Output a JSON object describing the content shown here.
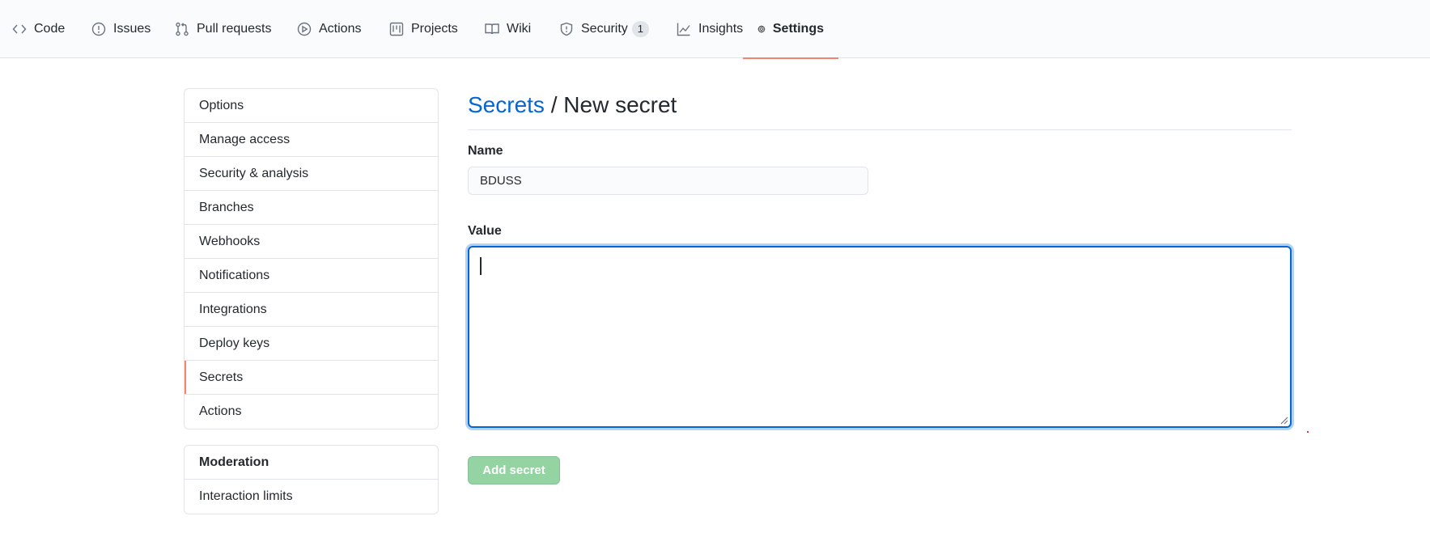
{
  "nav": {
    "tabs": [
      {
        "label": "Code",
        "icon": "code-icon"
      },
      {
        "label": "Issues",
        "icon": "issue-icon"
      },
      {
        "label": "Pull requests",
        "icon": "pull-request-icon"
      },
      {
        "label": "Actions",
        "icon": "play-icon"
      },
      {
        "label": "Projects",
        "icon": "project-icon"
      },
      {
        "label": "Wiki",
        "icon": "book-icon"
      },
      {
        "label": "Security",
        "icon": "shield-icon",
        "counter": "1"
      },
      {
        "label": "Insights",
        "icon": "graph-icon"
      },
      {
        "label": "Settings",
        "icon": "gear-icon",
        "selected": true
      }
    ]
  },
  "sidebar": {
    "items": [
      "Options",
      "Manage access",
      "Security & analysis",
      "Branches",
      "Webhooks",
      "Notifications",
      "Integrations",
      "Deploy keys",
      "Secrets",
      "Actions"
    ],
    "selected": "Secrets",
    "moderation": {
      "heading": "Moderation",
      "items": [
        "Interaction limits"
      ]
    }
  },
  "main": {
    "breadcrumb_link": "Secrets",
    "breadcrumb_sep": "/",
    "title": "New secret",
    "name_label": "Name",
    "name_value": "BDUSS",
    "value_label": "Value",
    "value_value": "",
    "submit_label": "Add secret"
  },
  "colors": {
    "accent": "#f9826c",
    "link": "#0366d6",
    "focus": "#0366d6",
    "button_disabled": "#94d3a2"
  }
}
